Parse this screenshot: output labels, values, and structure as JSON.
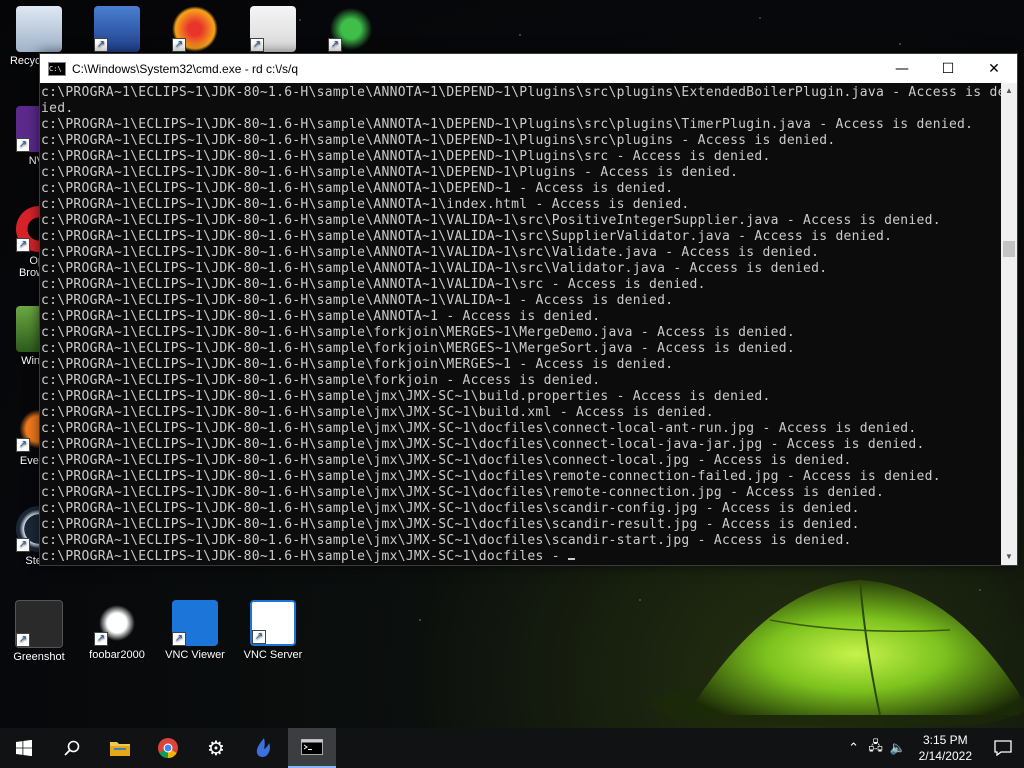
{
  "desktop": {
    "icons": [
      {
        "label": "Recycle Bin",
        "icon": "recycle-bin-icon"
      },
      {
        "label": "",
        "icon": "network-icon"
      },
      {
        "label": "",
        "icon": "eye-app-icon"
      },
      {
        "label": "",
        "icon": "doc-shortcut-icon"
      },
      {
        "label": "",
        "icon": "hummingbird-icon"
      },
      {
        "label": "NV",
        "icon": "nv-app-icon"
      },
      {
        "label": "Op Brow",
        "icon": "opera-icon"
      },
      {
        "label": "WinD",
        "icon": "windirstat-icon"
      },
      {
        "label": "Every",
        "icon": "everything-icon"
      },
      {
        "label": "Stea",
        "icon": "steam-icon"
      },
      {
        "label": "Greenshot",
        "icon": "greenshot-icon"
      },
      {
        "label": "foobar2000",
        "icon": "foobar2000-icon"
      },
      {
        "label": "VNC Viewer",
        "icon": "vnc-viewer-icon"
      },
      {
        "label": "VNC Server",
        "icon": "vnc-server-icon"
      }
    ]
  },
  "cmd_window": {
    "title": "C:\\Windows\\System32\\cmd.exe - rd  c:\\/s/q",
    "controls": {
      "minimize": "—",
      "maximize": "☐",
      "close": "✕"
    },
    "lines": [
      "c:\\PROGRA~1\\ECLIPS~1\\JDK-80~1.6-H\\sample\\ANNOTA~1\\DEPEND~1\\Plugins\\src\\plugins\\ExtendedBoilerPlugin.java - Access is denied",
      "ied.",
      "c:\\PROGRA~1\\ECLIPS~1\\JDK-80~1.6-H\\sample\\ANNOTA~1\\DEPEND~1\\Plugins\\src\\plugins\\TimerPlugin.java - Access is denied.",
      "c:\\PROGRA~1\\ECLIPS~1\\JDK-80~1.6-H\\sample\\ANNOTA~1\\DEPEND~1\\Plugins\\src\\plugins - Access is denied.",
      "c:\\PROGRA~1\\ECLIPS~1\\JDK-80~1.6-H\\sample\\ANNOTA~1\\DEPEND~1\\Plugins\\src - Access is denied.",
      "c:\\PROGRA~1\\ECLIPS~1\\JDK-80~1.6-H\\sample\\ANNOTA~1\\DEPEND~1\\Plugins - Access is denied.",
      "c:\\PROGRA~1\\ECLIPS~1\\JDK-80~1.6-H\\sample\\ANNOTA~1\\DEPEND~1 - Access is denied.",
      "c:\\PROGRA~1\\ECLIPS~1\\JDK-80~1.6-H\\sample\\ANNOTA~1\\index.html - Access is denied.",
      "c:\\PROGRA~1\\ECLIPS~1\\JDK-80~1.6-H\\sample\\ANNOTA~1\\VALIDA~1\\src\\PositiveIntegerSupplier.java - Access is denied.",
      "c:\\PROGRA~1\\ECLIPS~1\\JDK-80~1.6-H\\sample\\ANNOTA~1\\VALIDA~1\\src\\SupplierValidator.java - Access is denied.",
      "c:\\PROGRA~1\\ECLIPS~1\\JDK-80~1.6-H\\sample\\ANNOTA~1\\VALIDA~1\\src\\Validate.java - Access is denied.",
      "c:\\PROGRA~1\\ECLIPS~1\\JDK-80~1.6-H\\sample\\ANNOTA~1\\VALIDA~1\\src\\Validator.java - Access is denied.",
      "c:\\PROGRA~1\\ECLIPS~1\\JDK-80~1.6-H\\sample\\ANNOTA~1\\VALIDA~1\\src - Access is denied.",
      "c:\\PROGRA~1\\ECLIPS~1\\JDK-80~1.6-H\\sample\\ANNOTA~1\\VALIDA~1 - Access is denied.",
      "c:\\PROGRA~1\\ECLIPS~1\\JDK-80~1.6-H\\sample\\ANNOTA~1 - Access is denied.",
      "c:\\PROGRA~1\\ECLIPS~1\\JDK-80~1.6-H\\sample\\forkjoin\\MERGES~1\\MergeDemo.java - Access is denied.",
      "c:\\PROGRA~1\\ECLIPS~1\\JDK-80~1.6-H\\sample\\forkjoin\\MERGES~1\\MergeSort.java - Access is denied.",
      "c:\\PROGRA~1\\ECLIPS~1\\JDK-80~1.6-H\\sample\\forkjoin\\MERGES~1 - Access is denied.",
      "c:\\PROGRA~1\\ECLIPS~1\\JDK-80~1.6-H\\sample\\forkjoin - Access is denied.",
      "c:\\PROGRA~1\\ECLIPS~1\\JDK-80~1.6-H\\sample\\jmx\\JMX-SC~1\\build.properties - Access is denied.",
      "c:\\PROGRA~1\\ECLIPS~1\\JDK-80~1.6-H\\sample\\jmx\\JMX-SC~1\\build.xml - Access is denied.",
      "c:\\PROGRA~1\\ECLIPS~1\\JDK-80~1.6-H\\sample\\jmx\\JMX-SC~1\\docfiles\\connect-local-ant-run.jpg - Access is denied.",
      "c:\\PROGRA~1\\ECLIPS~1\\JDK-80~1.6-H\\sample\\jmx\\JMX-SC~1\\docfiles\\connect-local-java-jar.jpg - Access is denied.",
      "c:\\PROGRA~1\\ECLIPS~1\\JDK-80~1.6-H\\sample\\jmx\\JMX-SC~1\\docfiles\\connect-local.jpg - Access is denied.",
      "c:\\PROGRA~1\\ECLIPS~1\\JDK-80~1.6-H\\sample\\jmx\\JMX-SC~1\\docfiles\\remote-connection-failed.jpg - Access is denied.",
      "c:\\PROGRA~1\\ECLIPS~1\\JDK-80~1.6-H\\sample\\jmx\\JMX-SC~1\\docfiles\\remote-connection.jpg - Access is denied.",
      "c:\\PROGRA~1\\ECLIPS~1\\JDK-80~1.6-H\\sample\\jmx\\JMX-SC~1\\docfiles\\scandir-config.jpg - Access is denied.",
      "c:\\PROGRA~1\\ECLIPS~1\\JDK-80~1.6-H\\sample\\jmx\\JMX-SC~1\\docfiles\\scandir-result.jpg - Access is denied.",
      "c:\\PROGRA~1\\ECLIPS~1\\JDK-80~1.6-H\\sample\\jmx\\JMX-SC~1\\docfiles\\scandir-start.jpg - Access is denied.",
      "c:\\PROGRA~1\\ECLIPS~1\\JDK-80~1.6-H\\sample\\jmx\\JMX-SC~1\\docfiles - "
    ]
  },
  "taskbar": {
    "items": [
      {
        "icon": "start-windows-icon"
      },
      {
        "icon": "search-icon"
      },
      {
        "icon": "file-explorer-icon"
      },
      {
        "icon": "chrome-icon"
      },
      {
        "icon": "settings-gear-icon"
      },
      {
        "icon": "bird-app-icon"
      },
      {
        "icon": "cmd-icon",
        "active": true
      }
    ],
    "tray": {
      "time": "3:15 PM",
      "date": "2/14/2022",
      "icons": [
        "chevron-up-icon",
        "network-icon",
        "volume-icon"
      ]
    }
  },
  "colors": {
    "console_bg": "#0c0c0c",
    "console_text": "#cccccc",
    "taskbar_bg": "#101214",
    "tent_green": "#7cc21e"
  }
}
